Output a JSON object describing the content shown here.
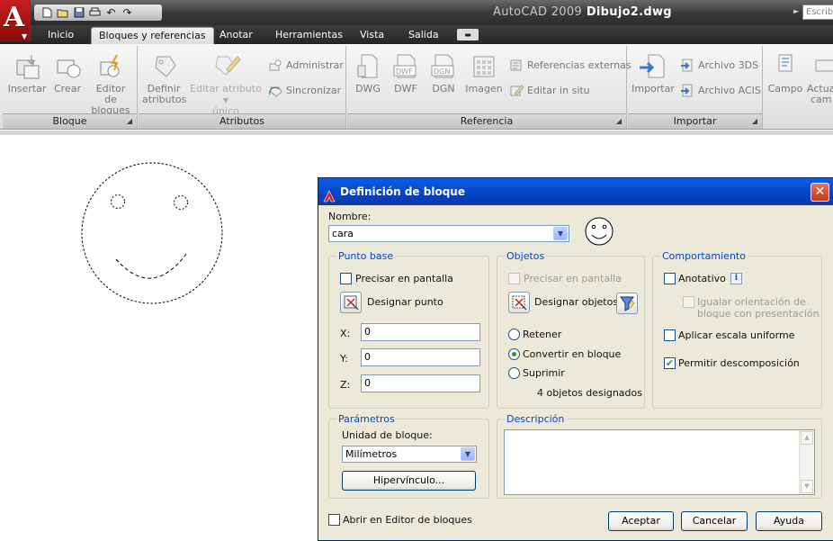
{
  "app": {
    "name": "AutoCAD 2009",
    "file": "Dibujo2.dwg",
    "help_placeholder": "Escrib"
  },
  "tabs": [
    {
      "label": "Inicio",
      "active": false
    },
    {
      "label": "Bloques y referencias",
      "active": true
    },
    {
      "label": "Anotar",
      "active": false
    },
    {
      "label": "Herramientas",
      "active": false
    },
    {
      "label": "Vista",
      "active": false
    },
    {
      "label": "Salida",
      "active": false
    }
  ],
  "ribbon": {
    "bloque": {
      "title": "Bloque",
      "insertar": "Insertar",
      "crear": "Crear",
      "editor_l1": "Editor de",
      "editor_l2": "bloques"
    },
    "atributos": {
      "title": "Atributos",
      "definir_l1": "Definir",
      "definir_l2": "atributos",
      "editar_l1": "Editar atributo",
      "editar_l2": "único",
      "administrar": "Administrar",
      "sincronizar": "Sincronizar"
    },
    "referencia": {
      "title": "Referencia",
      "dwg": "DWG",
      "dwf": "DWF",
      "dgn": "DGN",
      "imagen": "Imagen",
      "ref_externas": "Referencias externas",
      "editar_in_situ": "Editar in situ"
    },
    "importar": {
      "title": "Importar",
      "importar": "Importar",
      "archivo_3ds": "Archivo 3DS",
      "archivo_acis": "Archivo ACIS"
    },
    "campo": {
      "campo": "Campo",
      "actualizar_l1": "Actua",
      "actualizar_l2": "cam"
    }
  },
  "dialog": {
    "title": "Definición de bloque",
    "nombre_label": "Nombre:",
    "nombre_value": "cara",
    "punto_base": {
      "title": "Punto base",
      "precisar": "Precisar en pantalla",
      "precisar_checked": false,
      "designar": "Designar punto",
      "x_label": "X:",
      "x": "0",
      "y_label": "Y:",
      "y": "0",
      "z_label": "Z:",
      "z": "0"
    },
    "objetos": {
      "title": "Objetos",
      "precisar": "Precisar en pantalla",
      "designar": "Designar objetos",
      "retener": "Retener",
      "convertir": "Convertir en bloque",
      "suprimir": "Suprimir",
      "selected_option": "convertir",
      "count_text": "4 objetos designados"
    },
    "comportamiento": {
      "title": "Comportamiento",
      "anotativo": "Anotativo",
      "anotativo_checked": false,
      "igualar_l1": "Igualar orientación de",
      "igualar_l2": "bloque con presentación",
      "escala": "Aplicar escala uniforme",
      "escala_checked": false,
      "permitir": "Permitir descomposición",
      "permitir_checked": true
    },
    "parametros": {
      "title": "Parámetros",
      "unidad_label": "Unidad de bloque:",
      "unidad_value": "Milímetros",
      "hipervinculo": "Hipervínculo..."
    },
    "descripcion": {
      "title": "Descripción",
      "value": ""
    },
    "abrir_editor": "Abrir en Editor de bloques",
    "abrir_editor_checked": false,
    "aceptar": "Aceptar",
    "cancelar": "Cancelar",
    "ayuda": "Ayuda"
  },
  "colors": {
    "dialog_title": "#0542c4",
    "group_title": "#0046d5",
    "check_mark": "#21a121",
    "logo_red": "#c81e1e"
  }
}
